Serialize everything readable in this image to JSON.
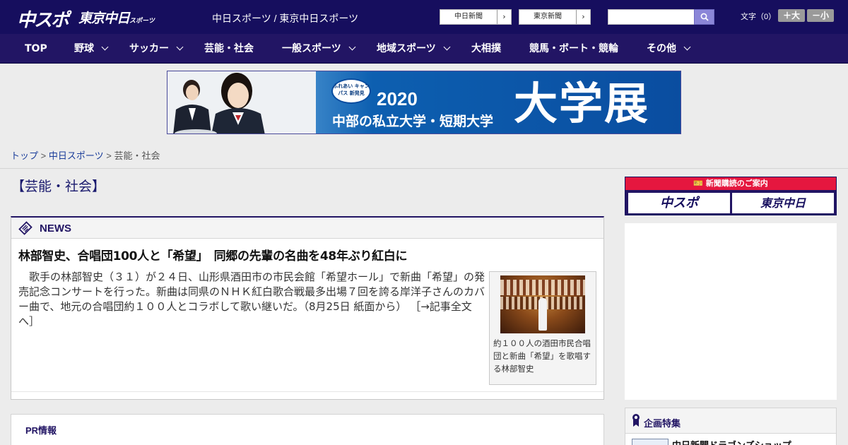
{
  "header": {
    "logo_chuspo": "中スポ",
    "logo_tokyo": "東京中日",
    "logo_tokyo_small": "スポーツ",
    "tagline": "中日スポーツ / 東京中日スポーツ",
    "links": [
      "中日新聞",
      "東京新聞"
    ],
    "search_placeholder": "",
    "font_label": "文字（0）",
    "font_bigger": "＋大",
    "font_smaller": "－小"
  },
  "nav": {
    "items": [
      "TOP",
      "野球",
      "サッカー",
      "芸能・社会",
      "一般スポーツ",
      "地域スポーツ",
      "大相撲",
      "競馬・ボート・競輪",
      "その他"
    ]
  },
  "banner": {
    "badge": "ふれあい キャンパス 新発見",
    "year": "2020",
    "subtitle": "中部の私立大学・短期大学",
    "title": "大学展"
  },
  "breadcrumb": {
    "top": "トップ",
    "section": "中日スポーツ",
    "current": "芸能・社会",
    "sep": ">"
  },
  "page_heading": "【芸能・社会】",
  "news": {
    "label": "NEWS",
    "title": "林部智史、合唱団100人と「希望」　同郷の先輩の名曲を48年ぶり紅白に",
    "body": "　歌手の林部智史（３１）が２４日、山形県酒田市の市民会館「希望ホール」で新曲「希望」の発売記念コンサートを行った。新曲は同県のＮＨＫ紅白歌合戦最多出場７回を誇る岸洋子さんのカバー曲で、地元の合唱団約１００人とコラボして歌い継いだ。（8月25日 紙面から）",
    "more": "［→記事全文へ］",
    "photo_caption": "約１００人の酒田市民合唱団と新曲「希望」を歌唱する林部智史"
  },
  "pr": {
    "label": "PR情報"
  },
  "sidebar": {
    "subscribe_label": "新聞購読のご案内",
    "logo_chuspo": "中スポ",
    "logo_tokyo": "東京中日",
    "special_label": "企画特集",
    "special_item": "中日新聞ドラゴンズショップ"
  },
  "colors": {
    "header_bg": "#160e5e",
    "nav_bg": "#221564",
    "accent_red": "#e5173f",
    "link": "#1a3d9a"
  }
}
